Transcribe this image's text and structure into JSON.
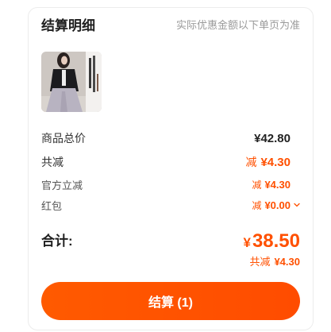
{
  "header": {
    "title": "结算明细",
    "note": "实际优惠金额以下单页为准"
  },
  "rows": [
    {
      "label": "商品总价",
      "value": "¥42.80"
    },
    {
      "label": "共减",
      "prefix": "减",
      "value": "¥4.30"
    },
    {
      "label": "官方立减",
      "prefix": "减",
      "value": "¥4.30"
    },
    {
      "label": "红包",
      "prefix": "减",
      "value": "¥0.00",
      "icon": "chevron-down-icon"
    }
  ],
  "total": {
    "label": "合计:",
    "currency": "¥",
    "amount": "38.50",
    "discount_label": "共减",
    "discount_value": "¥4.30"
  },
  "checkout": {
    "label": "结算 (1)"
  },
  "colors": {
    "accent": "#FF5000",
    "text": "#222222",
    "muted": "#9A9A9A",
    "button_text": "#FFFFFF"
  }
}
